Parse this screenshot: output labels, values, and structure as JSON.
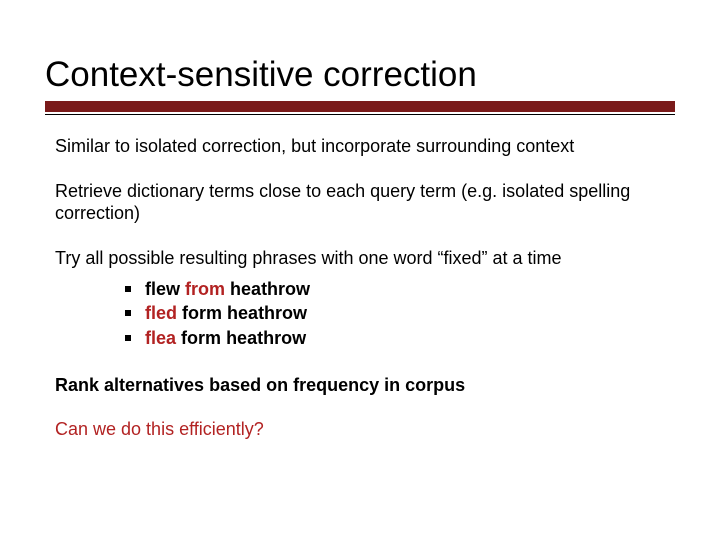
{
  "title": "Context-sensitive correction",
  "para1": "Similar to isolated correction, but incorporate surrounding context",
  "para2": "Retrieve dictionary terms close to each query term (e.g. isolated spelling correction)",
  "para3": "Try all possible resulting phrases with one word “fixed” at a time",
  "examples": [
    {
      "w1": "flew",
      "w2": "from",
      "w3": "heathrow",
      "fix": 2
    },
    {
      "w1": "fled",
      "w2": "form",
      "w3": "heathrow",
      "fix": 1
    },
    {
      "w1": "flea",
      "w2": "form",
      "w3": "heathrow",
      "fix": 1
    }
  ],
  "para4": "Rank alternatives based on frequency in corpus",
  "para5": "Can we do this efficiently?"
}
